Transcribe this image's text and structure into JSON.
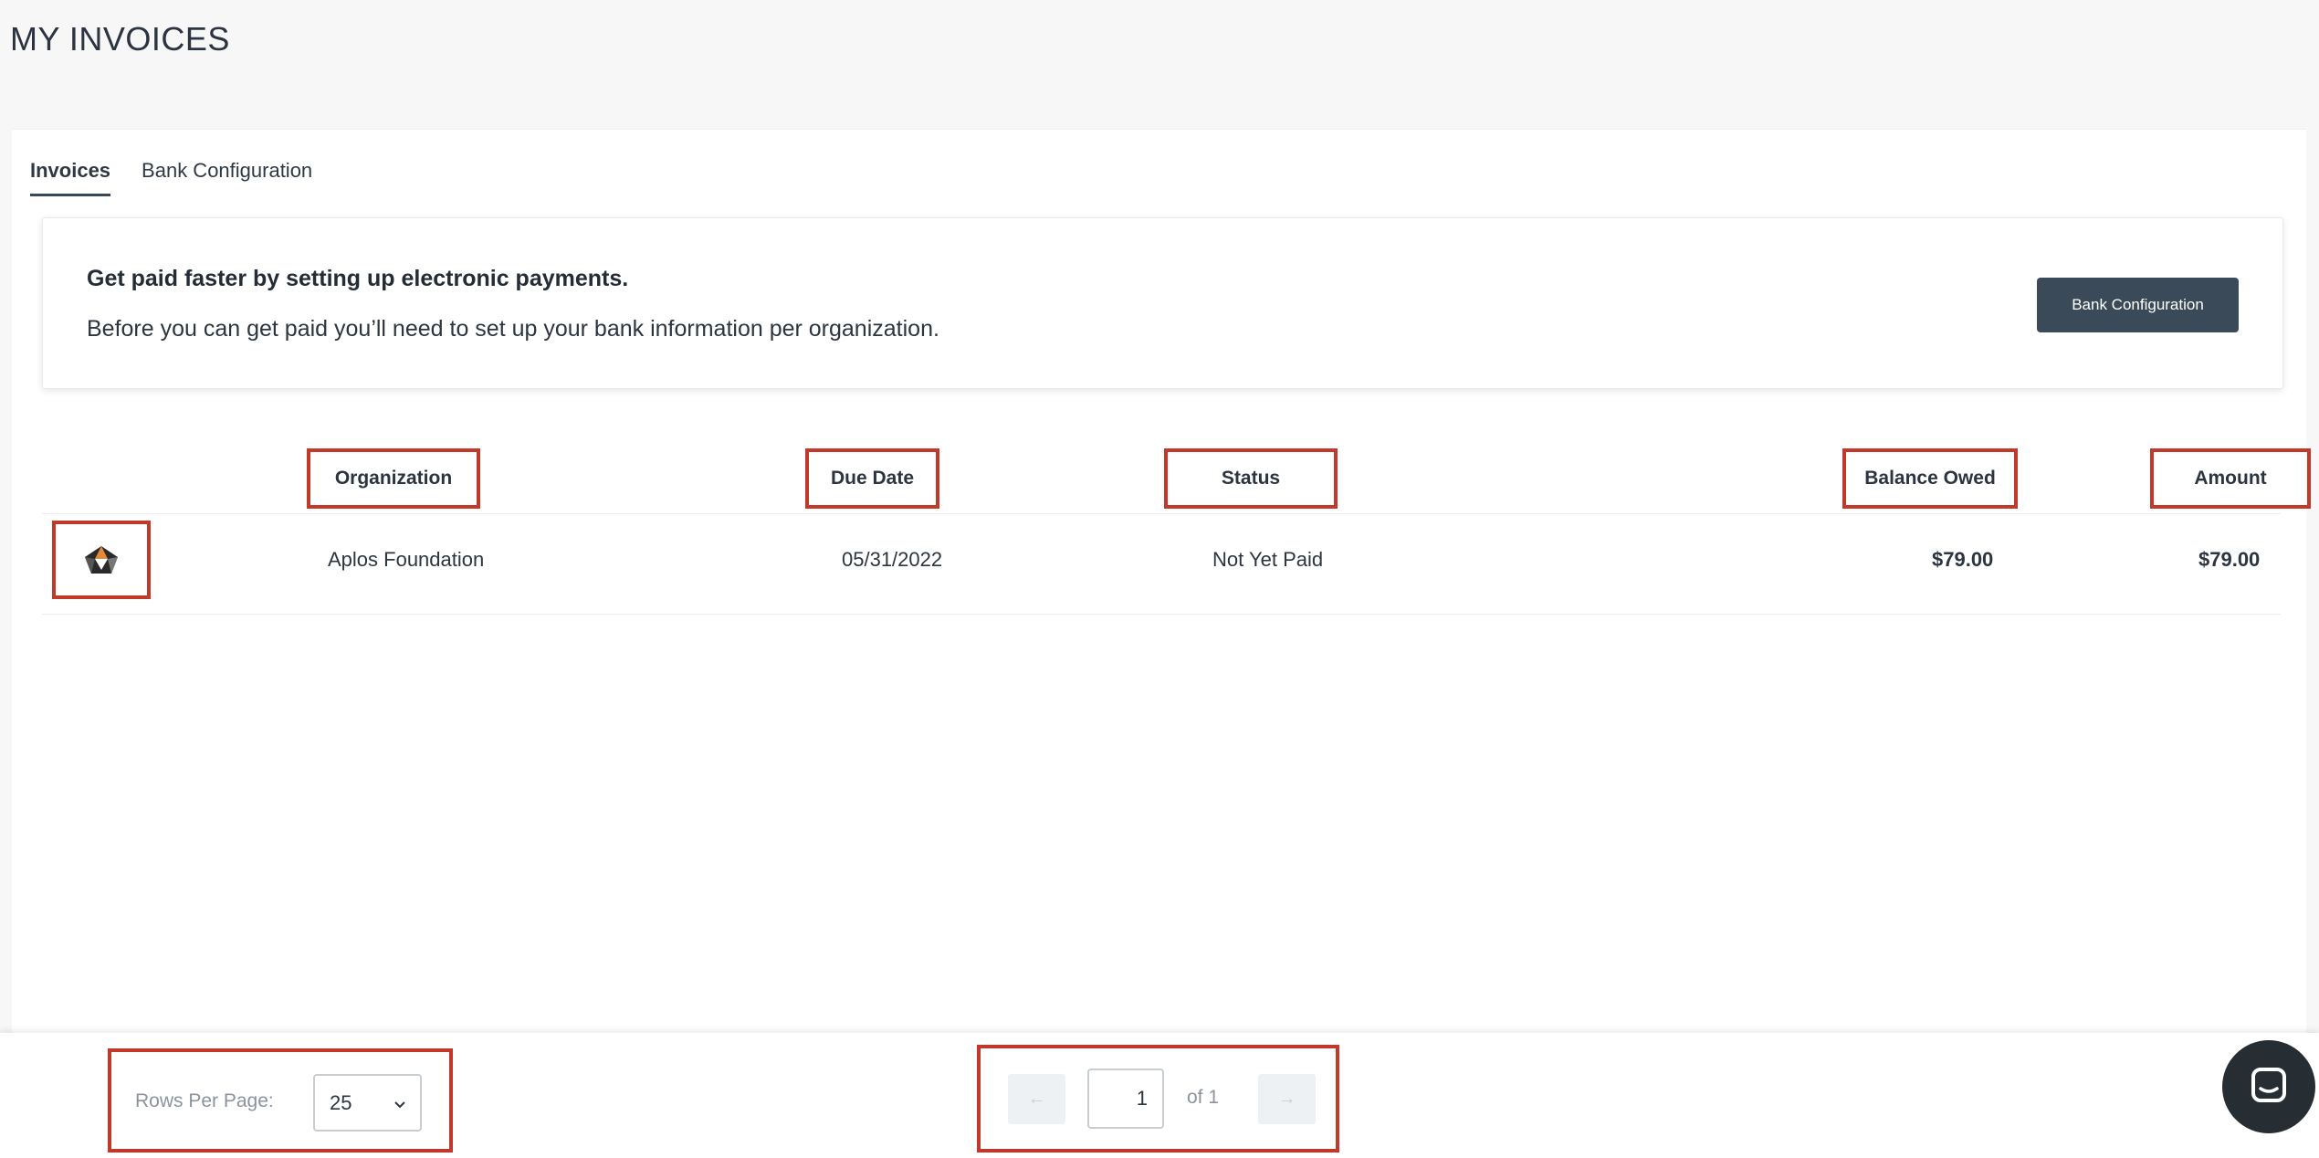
{
  "page": {
    "title": "MY INVOICES"
  },
  "tabs": [
    {
      "label": "Invoices",
      "active": true
    },
    {
      "label": "Bank Configuration",
      "active": false
    }
  ],
  "banner": {
    "title": "Get paid faster by setting up electronic payments.",
    "text": "Before you can get paid you’ll need to set up your bank information per organization.",
    "button_label": "Bank Configuration"
  },
  "table": {
    "columns": [
      "Organization",
      "Due Date",
      "Status",
      "Balance Owed",
      "Amount"
    ],
    "rows": [
      {
        "logo_icon": "organization-logo-icon",
        "organization": "Aplos Foundation",
        "due_date": "05/31/2022",
        "status": "Not Yet Paid",
        "balance_owed": "$79.00",
        "amount": "$79.00"
      }
    ]
  },
  "footer": {
    "rows_per_page_label": "Rows Per Page:",
    "rows_per_page_value": "25",
    "page_current": "1",
    "page_of": "of 1",
    "prev_icon": "arrow-left-icon",
    "next_icon": "arrow-right-icon"
  },
  "chat": {
    "icon": "chat-bubble-icon"
  },
  "colors": {
    "accent_button": "#3a4a59",
    "highlight_border": "#c0392b",
    "chat_button": "#262d33"
  }
}
